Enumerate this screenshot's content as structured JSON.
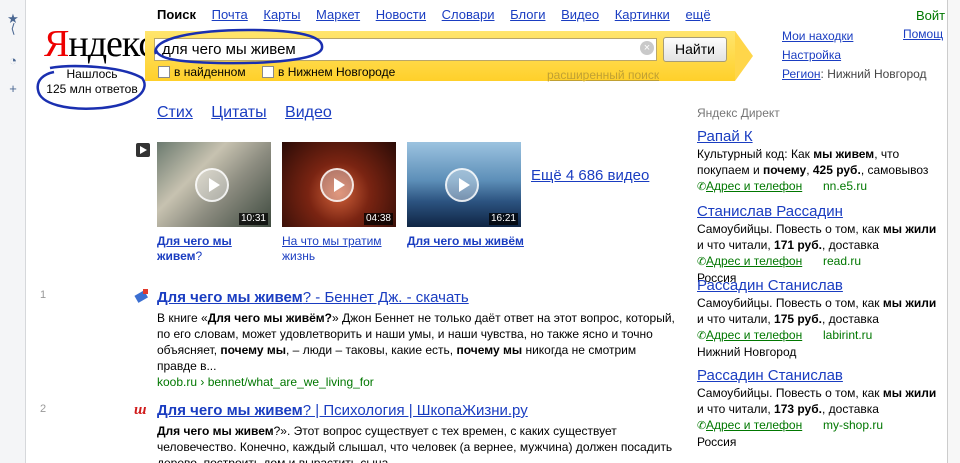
{
  "left_bar": {
    "icons": [
      "star-icon",
      "share-icon",
      "clock-icon",
      "plus-icon"
    ]
  },
  "logo": {
    "first_letter": "Я",
    "rest": "ндекс"
  },
  "found": {
    "line1": "Нашлось",
    "line2": "125 млн ответов"
  },
  "services": {
    "current": "Поиск",
    "items": [
      "Почта",
      "Карты",
      "Маркет",
      "Новости",
      "Словари",
      "Блоги",
      "Видео",
      "Картинки",
      "ещё"
    ]
  },
  "search": {
    "value": "для чего мы живем",
    "button": "Найти",
    "check_found": "в найденном",
    "check_region": "в Нижнем Новгороде",
    "advanced": "расширенный поиск"
  },
  "right_links": {
    "my_finds": "Мои находки",
    "settings": "Настройка",
    "region_label": "Регион",
    "region_value": ": Нижний Новгород"
  },
  "top_right": {
    "login": "Войт",
    "help": "Помощ"
  },
  "tabs": [
    "Стих",
    "Цитаты",
    "Видео"
  ],
  "videos": {
    "items": [
      {
        "duration": "10:31",
        "title_bold": "Для чего мы",
        "title_rest": "живем",
        "title_tail": "?"
      },
      {
        "duration": "04:38",
        "title_bold": "",
        "title_rest": "На что ",
        "title_tail": "мы тратим жизнь"
      },
      {
        "duration": "16:21",
        "title_bold": "Для чего мы",
        "title_rest": "живём",
        "title_tail": ""
      }
    ],
    "more": "Ещё 4 686 видео"
  },
  "results": [
    {
      "num": "1",
      "favicon": "koob-icon",
      "title_bold": "Для чего мы живем",
      "title_rest": "? - Беннет Дж. - скачать",
      "snippet": [
        [
          "В книге «",
          false
        ],
        [
          "Для чего мы живём?",
          true
        ],
        [
          "» Джон Беннет не только даёт ответ на этот вопрос, который, по его словам, может удовлетворить и наши умы, и наши чувства, но также ясно и точно объясняет, ",
          false
        ],
        [
          "почему мы",
          true
        ],
        [
          ", – люди – таковы, какие есть, ",
          false
        ],
        [
          "почему мы",
          true
        ],
        [
          " никогда не смотрим правде в...",
          false
        ]
      ],
      "url": "koob.ru › bennet/what_are_we_living_for"
    },
    {
      "num": "2",
      "favicon": "shkolazhizni-icon",
      "title_bold": "Для чего мы живем",
      "title_rest": "? | Психология | ШкопаЖизни.ру",
      "snippet": [
        [
          "Для чего мы живем",
          true
        ],
        [
          "?». Этот вопрос существует с тех времен, с каких существует человечество. Конечно, каждый слышал, что человек (а вернее, мужчина) должен посадить дерево, построить дом и вырастить сына...",
          false
        ]
      ],
      "url": ""
    }
  ],
  "direct": {
    "label": "Яндекс Директ",
    "address_label": "Адрес и телефон",
    "ads": [
      {
        "title": "Рапай К",
        "text": [
          [
            "Культурный код: Как ",
            false
          ],
          [
            "мы живем",
            true
          ],
          [
            ", что покупаем и ",
            false
          ],
          [
            "почему",
            true
          ],
          [
            ", ",
            false
          ],
          [
            "425 руб.",
            true
          ],
          [
            ", самовывоз",
            false
          ]
        ],
        "site": "nn.e5.ru",
        "region": ""
      },
      {
        "title": "Станислав Рассадин",
        "text": [
          [
            "Самоубийцы. Повесть о том, как ",
            false
          ],
          [
            "мы жили",
            true
          ],
          [
            " и что читали, ",
            false
          ],
          [
            "171 руб.",
            true
          ],
          [
            ", доставка",
            false
          ]
        ],
        "site": "read.ru",
        "region": "Россия"
      },
      {
        "title": "Рассадин Станислав",
        "text": [
          [
            "Самоубийцы. Повесть о том, как ",
            false
          ],
          [
            "мы жили",
            true
          ],
          [
            " и что читали, ",
            false
          ],
          [
            "175 руб.",
            true
          ],
          [
            ", доставка",
            false
          ]
        ],
        "site": "labirint.ru",
        "region": "Нижний Новгород"
      },
      {
        "title": "Рассадин Станислав",
        "text": [
          [
            "Самоубийцы. Повесть о том, как ",
            false
          ],
          [
            "мы жили",
            true
          ],
          [
            " и что читали, ",
            false
          ],
          [
            "173 руб.",
            true
          ],
          [
            ", доставка",
            false
          ]
        ],
        "site": "my-shop.ru",
        "region": "Россия"
      }
    ]
  },
  "colors": {
    "link": "#1a3dc1",
    "url_green": "#007700",
    "accent_yellow": "#ffd02a",
    "logo_red": "#ee0000",
    "annotation_blue": "#1a2fb0"
  }
}
